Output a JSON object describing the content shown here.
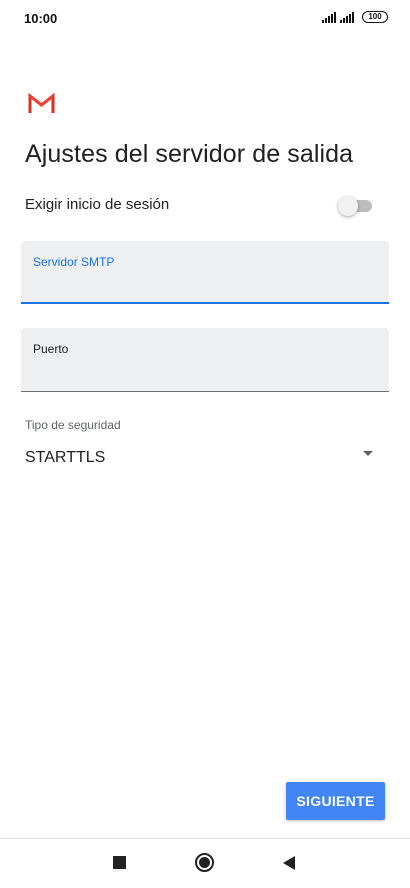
{
  "status_bar": {
    "time": "10:00",
    "battery": "100"
  },
  "app": {
    "logo_icon": "gmail-logo",
    "brand_color": "#d93025"
  },
  "page": {
    "title": "Ajustes del servidor de salida"
  },
  "login_toggle": {
    "label": "Exigir inicio de sesión",
    "enabled": false
  },
  "smtp_field": {
    "label": "Servidor SMTP",
    "value": "",
    "focused": true
  },
  "port_field": {
    "label": "Puerto",
    "value": ""
  },
  "security": {
    "label": "Tipo de seguridad",
    "selected": "STARTTLS"
  },
  "actions": {
    "next_label": "SIGUIENTE"
  },
  "colors": {
    "accent": "#1a73e8",
    "button": "#4285f4",
    "field_background": "#eeeff1"
  },
  "nav_bar": {
    "icons": [
      "recents-icon",
      "home-icon",
      "back-icon"
    ]
  }
}
